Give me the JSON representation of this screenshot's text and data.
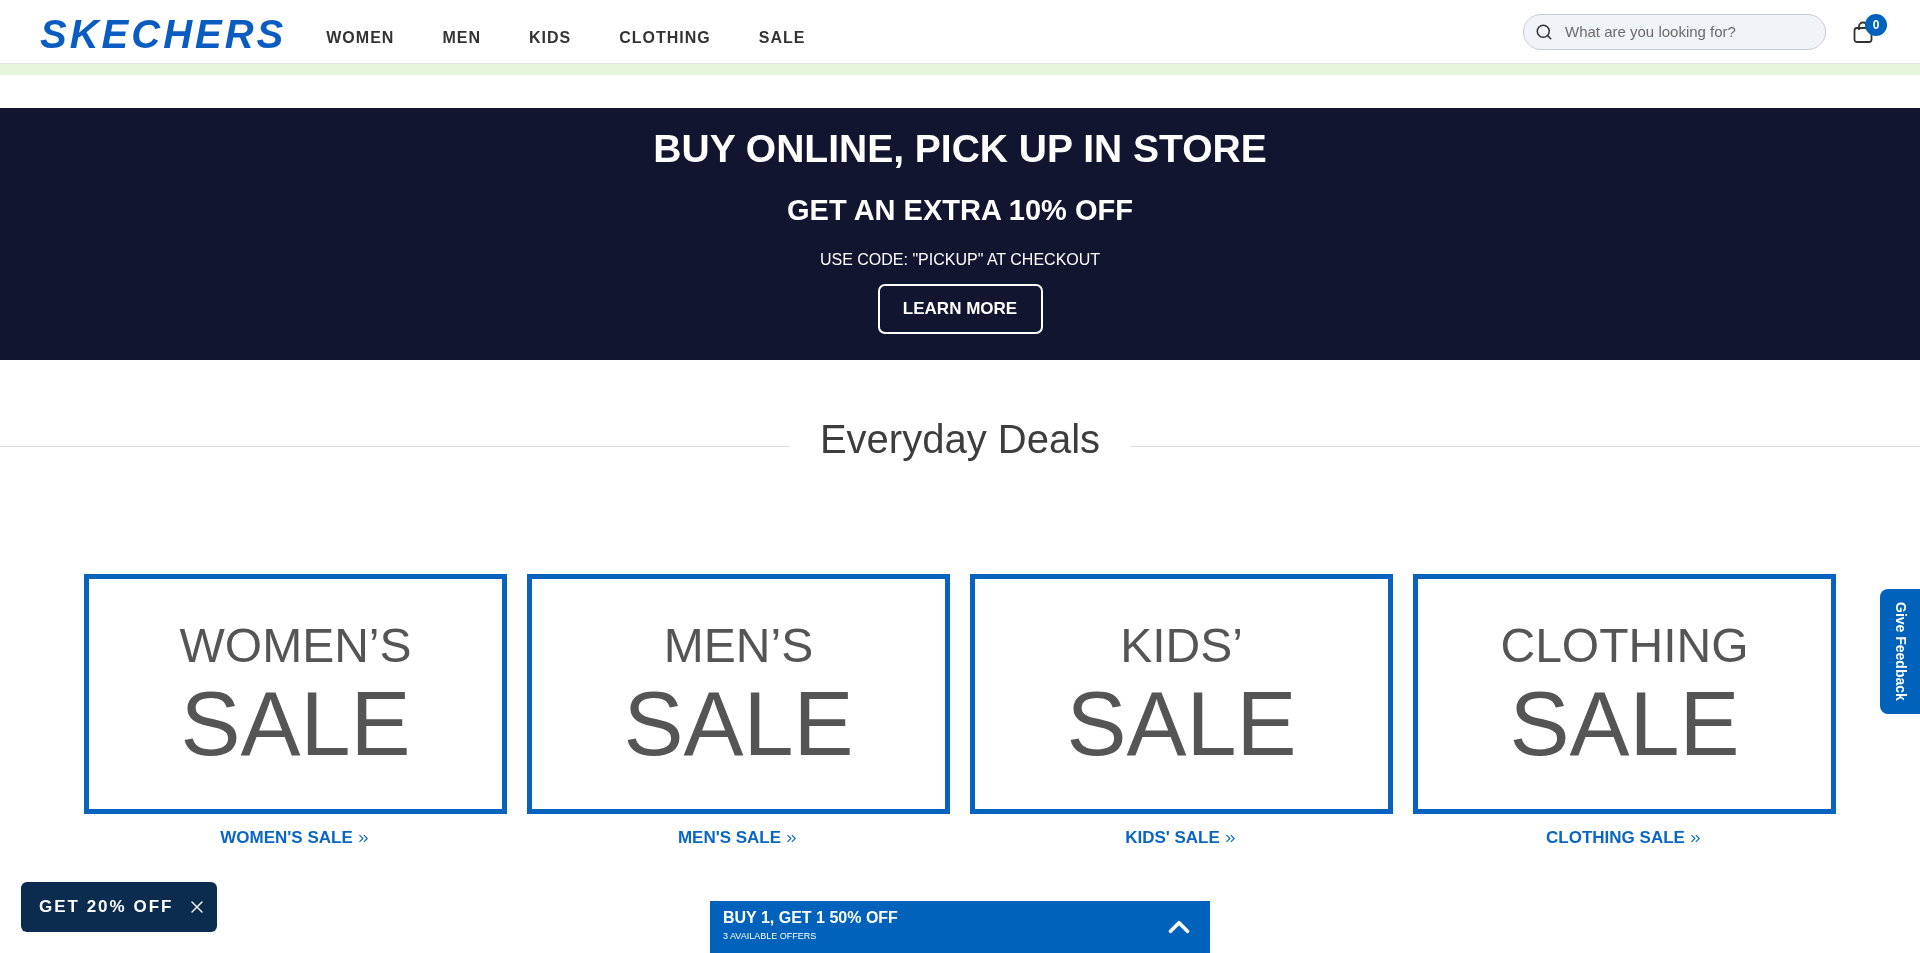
{
  "header": {
    "logo": "SKECHERS",
    "nav": [
      "WOMEN",
      "MEN",
      "KIDS",
      "CLOTHING",
      "SALE"
    ],
    "search": {
      "placeholder": "What are you looking for?"
    },
    "cart_count": "0"
  },
  "promo_banner": {
    "title": "BUY ONLINE, PICK UP IN STORE",
    "subtitle": "GET AN EXTRA 10% OFF",
    "code_text": "USE CODE: \"PICKUP\" AT CHECKOUT",
    "button": "LEARN MORE"
  },
  "everyday_deals": {
    "title": "Everyday Deals",
    "tiles": [
      {
        "heading": "WOMEN’S",
        "sale": "SALE",
        "link": "WOMEN'S SALE"
      },
      {
        "heading": "MEN’S",
        "sale": "SALE",
        "link": "MEN'S SALE"
      },
      {
        "heading": "KIDS’",
        "sale": "SALE",
        "link": "KIDS' SALE"
      },
      {
        "heading": "CLOTHING",
        "sale": "SALE",
        "link": "CLOTHING SALE"
      }
    ]
  },
  "feedback_tab": {
    "label": "Give Feedback"
  },
  "discount_popup": {
    "label": "GET 20% OFF"
  },
  "offers_bar": {
    "title": "BUY 1, GET 1 50% OFF",
    "subtitle": "3 AVAILABLE OFFERS"
  }
}
